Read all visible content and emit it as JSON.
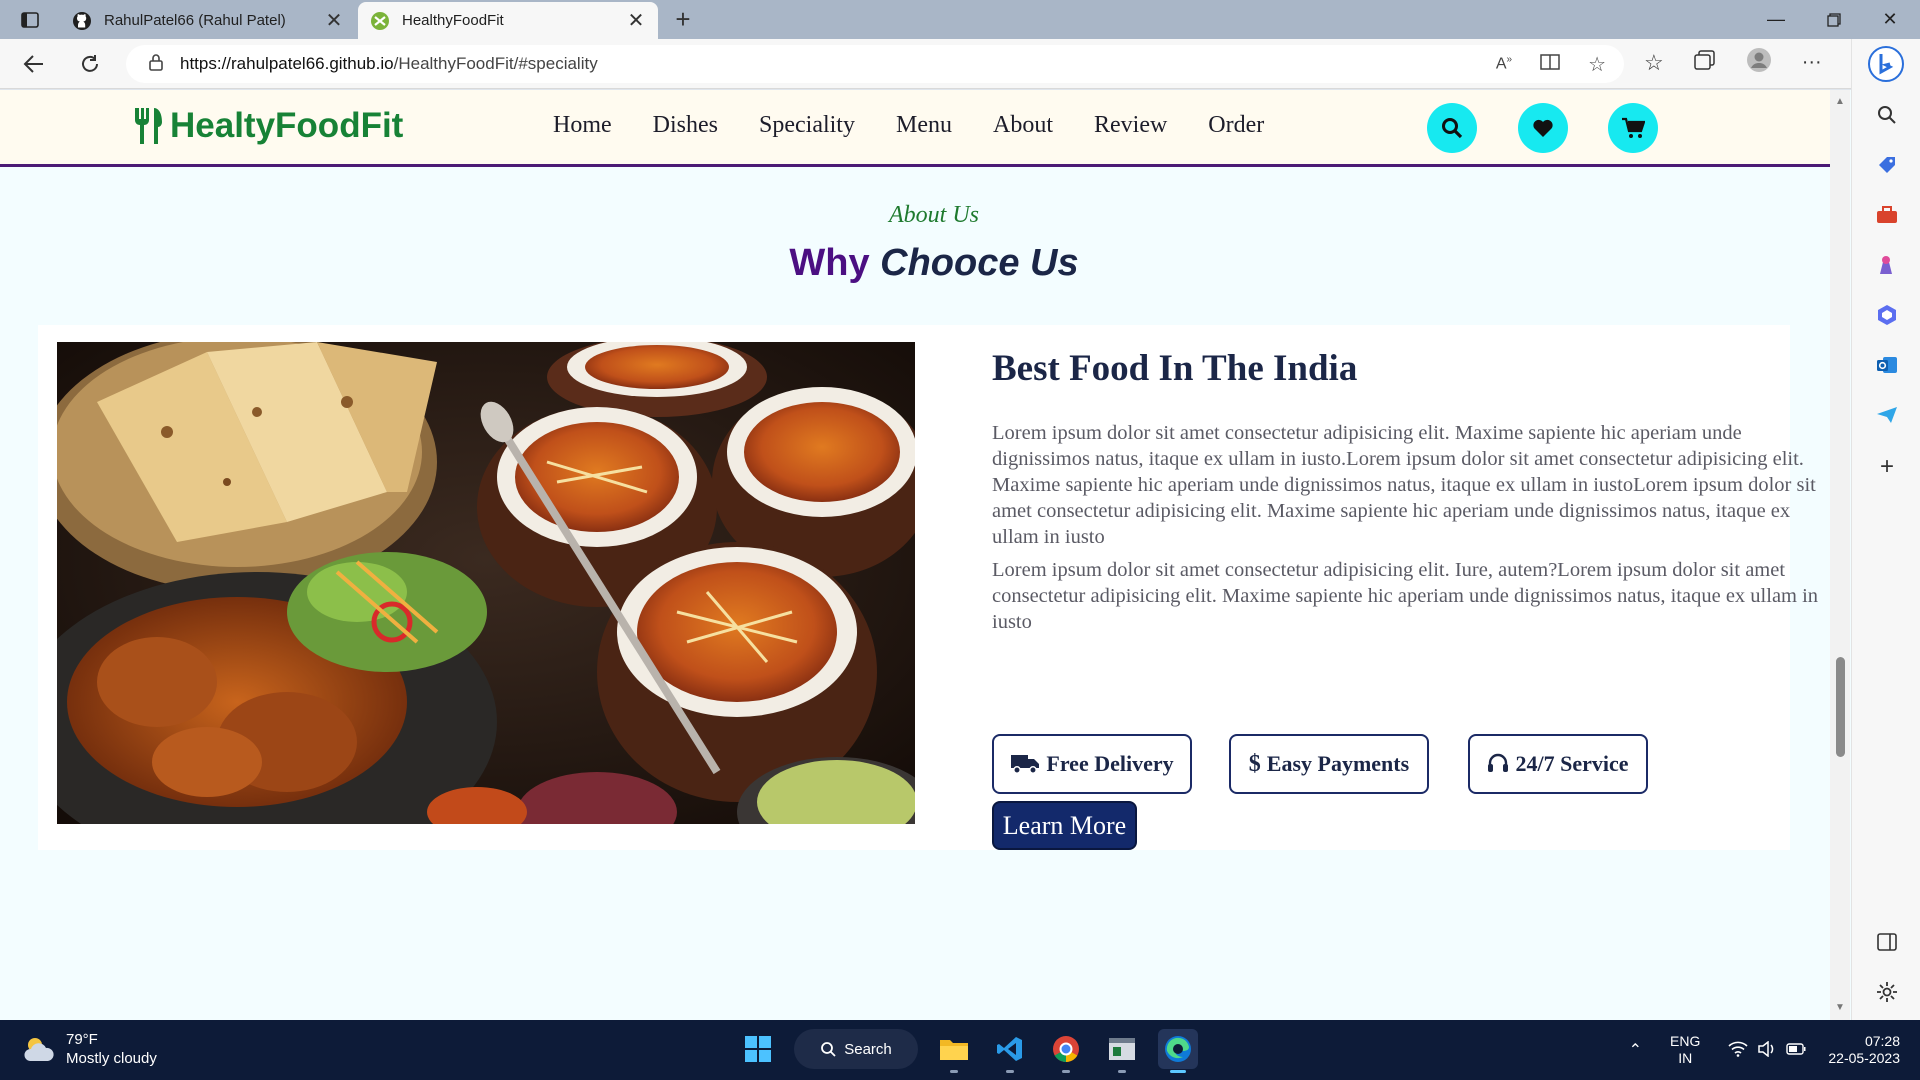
{
  "browser": {
    "tabs": [
      {
        "title": "RahulPatel66 (Rahul Patel)",
        "active": false
      },
      {
        "title": "HealthyFoodFit",
        "active": true
      }
    ],
    "url_host": "https://rahulpatel66.github.io",
    "url_path": "/HealthyFoodFit/#speciality"
  },
  "site": {
    "logo": "HealtyFoodFit",
    "nav": [
      "Home",
      "Dishes",
      "Speciality",
      "Menu",
      "About",
      "Review",
      "Order"
    ]
  },
  "about": {
    "sub_heading": "About Us",
    "heading_plain": "Why ",
    "heading_em": "Chooce Us",
    "title": "Best Food In The India",
    "paragraph1": "Lorem ipsum dolor sit amet consectetur adipisicing elit. Maxime sapiente hic aperiam unde dignissimos natus, itaque ex ullam in iusto.Lorem ipsum dolor sit amet consectetur adipisicing elit. Maxime sapiente hic aperiam unde dignissimos natus, itaque ex ullam in iustoLorem ipsum dolor sit amet consectetur adipisicing elit. Maxime sapiente hic aperiam unde dignissimos natus, itaque ex ullam in iusto",
    "paragraph2": "Lorem ipsum dolor sit amet consectetur adipisicing elit. Iure, autem?Lorem ipsum dolor sit amet consectetur adipisicing elit. Maxime sapiente hic aperiam unde dignissimos natus, itaque ex ullam in iusto",
    "features": [
      "Free Delivery",
      "Easy Payments",
      "24/7 Service"
    ],
    "learn_more": "Learn More"
  },
  "taskbar": {
    "temperature": "79°F",
    "weather": "Mostly cloudy",
    "search": "Search",
    "lang_line1": "ENG",
    "lang_line2": "IN",
    "time": "07:28",
    "date": "22-05-2023"
  },
  "colors": {
    "accent_cyan": "#17e9f0",
    "logo_green": "#178236",
    "heading_purple": "#4b0f82",
    "navy": "#1b2647"
  }
}
